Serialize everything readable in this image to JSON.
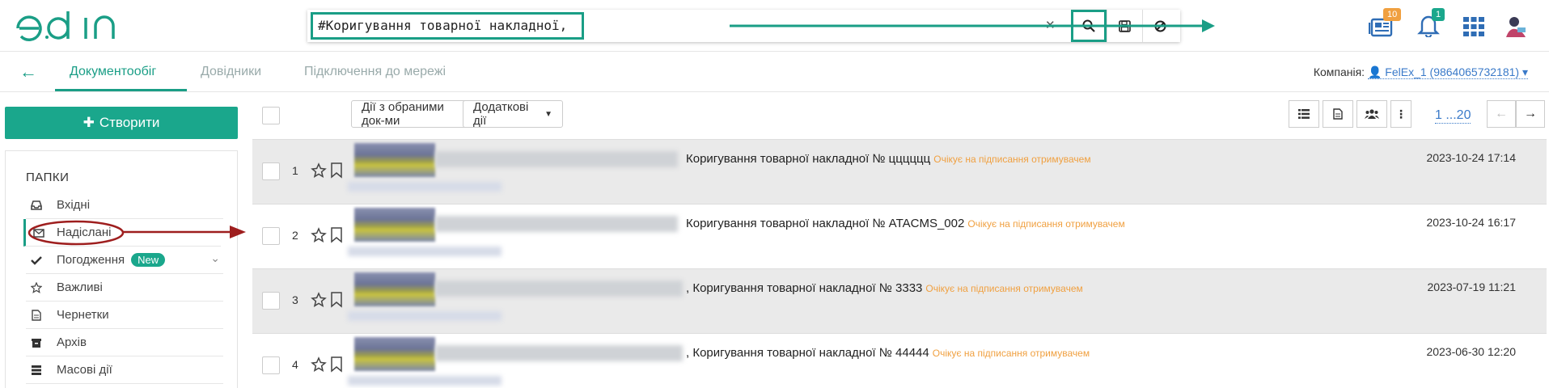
{
  "brand": {
    "logo_text": "edin",
    "accent": "#1a9e86"
  },
  "search": {
    "value": "#Коригування товарної накладної,",
    "buttons": [
      "search-icon",
      "save-icon",
      "block-icon"
    ]
  },
  "top_icons": {
    "news_badge": "10",
    "bell_badge": "1"
  },
  "nav": {
    "tabs": [
      "Документообіг",
      "Довідники",
      "Підключення до мережі"
    ],
    "company_label": "Компанія:",
    "company_value": "FelEx_1 (9864065732181)"
  },
  "sidebar": {
    "create_label": "Створити",
    "folders_title": "ПАПКИ",
    "items": [
      {
        "label": "Вхідні",
        "icon": "inbox-icon"
      },
      {
        "label": "Надіслані",
        "icon": "envelope-icon"
      },
      {
        "label": "Погодження",
        "icon": "check-icon",
        "badge": "New"
      },
      {
        "label": "Важливі",
        "icon": "star-icon"
      },
      {
        "label": "Чернетки",
        "icon": "draft-icon"
      },
      {
        "label": "Архів",
        "icon": "archive-icon"
      },
      {
        "label": "Масові дії",
        "icon": "mass-icon"
      }
    ]
  },
  "toolbar": {
    "bulk_actions": "Дії з обраними док-ми",
    "extra_actions": "Додаткові дії",
    "pager": "1 ...20"
  },
  "documents": [
    {
      "num": "1",
      "title": "Коригування товарної накладної № цццццц",
      "status": "Очікує на підписання отримувачем",
      "date": "2023-10-24 17:14"
    },
    {
      "num": "2",
      "title": "Коригування товарної накладної № ATACMS_002",
      "status": "Очікує на підписання отримувачем",
      "date": "2023-10-24 16:17"
    },
    {
      "num": "3",
      "title": ", Коригування товарної накладної № 3333",
      "status": "Очікує на підписання отримувачем",
      "date": "2023-07-19 11:21"
    },
    {
      "num": "4",
      "title": ", Коригування товарної накладної № 44444",
      "status": "Очікує на підписання отримувачем",
      "date": "2023-06-30 12:20"
    }
  ]
}
